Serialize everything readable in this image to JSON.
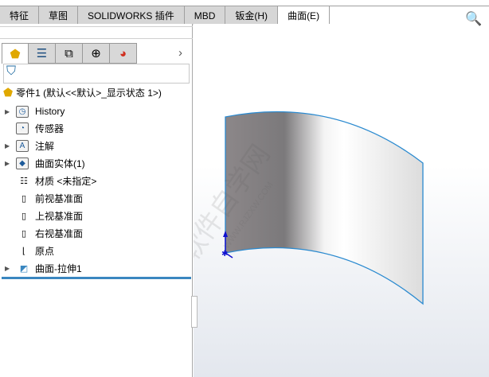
{
  "tabs": [
    "特征",
    "草图",
    "SOLIDWORKS 插件",
    "MBD",
    "钣金(H)",
    "曲面(E)"
  ],
  "active_tab": "曲面(E)",
  "panel": {
    "tab_icons": [
      "feature-manager-icon",
      "property-manager-icon",
      "configuration-manager-icon",
      "dimxpert-icon",
      "display-manager-icon"
    ],
    "more": "›",
    "filter_icon": "⛉",
    "root": "零件1  (默认<<默认>_显示状态 1>)",
    "items": [
      {
        "label": "History",
        "icon": "history-icon",
        "expand": true
      },
      {
        "label": "传感器",
        "icon": "sensor-icon",
        "expand": false
      },
      {
        "label": "注解",
        "icon": "annotation-icon",
        "expand": true
      },
      {
        "label": "曲面实体(1)",
        "icon": "surface-bodies-icon",
        "expand": true
      },
      {
        "label": "材质 <未指定>",
        "icon": "material-icon",
        "expand": false
      },
      {
        "label": "前视基准面",
        "icon": "plane-icon",
        "expand": false
      },
      {
        "label": "上视基准面",
        "icon": "plane-icon",
        "expand": false
      },
      {
        "label": "右视基准面",
        "icon": "plane-icon",
        "expand": false
      },
      {
        "label": "原点",
        "icon": "origin-icon",
        "expand": false
      },
      {
        "label": "曲面-拉伸1",
        "icon": "surface-extrude-icon",
        "expand": true
      }
    ]
  },
  "watermark": {
    "main": "软件自学网",
    "url": "WWW.RJZXW.COM"
  },
  "colors": {
    "accent": "#3a87c0",
    "edge": "#2a8ad0"
  }
}
